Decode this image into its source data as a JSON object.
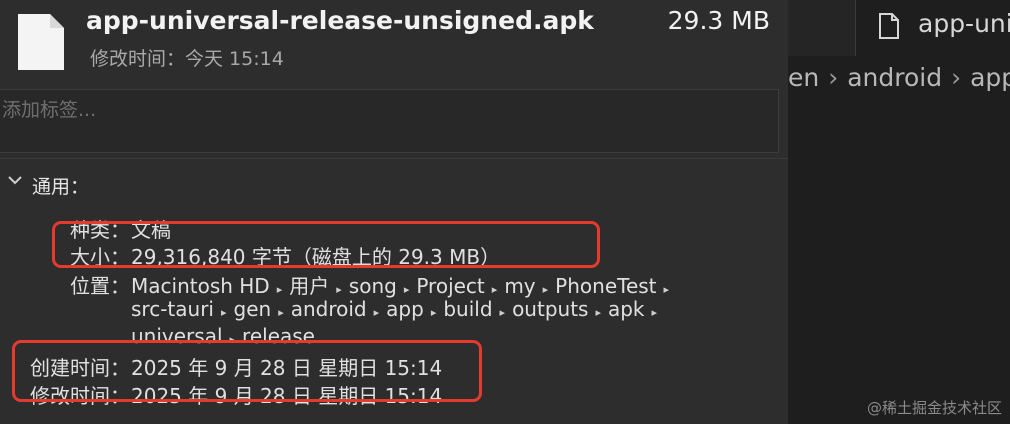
{
  "header": {
    "file_name": "app-universal-release-unsigned.apk",
    "file_size": "29.3 MB",
    "modified_label": "修改时间：",
    "modified_value": "今天 15:14"
  },
  "tags": {
    "placeholder": "添加标签..."
  },
  "general": {
    "title": "通用：",
    "kind_label": "种类：",
    "kind_value": "文稿",
    "size_label": "大小：",
    "size_value": "29,316,840 字节（磁盘上的 29.3 MB）",
    "location_label": "位置：",
    "path_line1": [
      "Macintosh HD",
      "用户",
      "song",
      "Project",
      "my",
      "PhoneTest"
    ],
    "path_line2": [
      "src-tauri",
      "gen",
      "android",
      "app",
      "build",
      "outputs",
      "apk"
    ],
    "path_line3": [
      "universal",
      "release"
    ],
    "created_label": "创建时间：",
    "created_value": "2025 年 9 月 28 日 星期日 15:14",
    "modified_label": "修改时间：",
    "modified_value": "2025 年 9 月 28 日 星期日 15:14"
  },
  "editor": {
    "tab_label": "app-uni",
    "breadcrumb": [
      "en",
      "android",
      "app"
    ]
  },
  "watermark": "@稀土掘金技术社区",
  "colors": {
    "highlight": "#e53a2f",
    "panel_bg": "#2d2d2d",
    "editor_bg": "#1e1e1e"
  }
}
